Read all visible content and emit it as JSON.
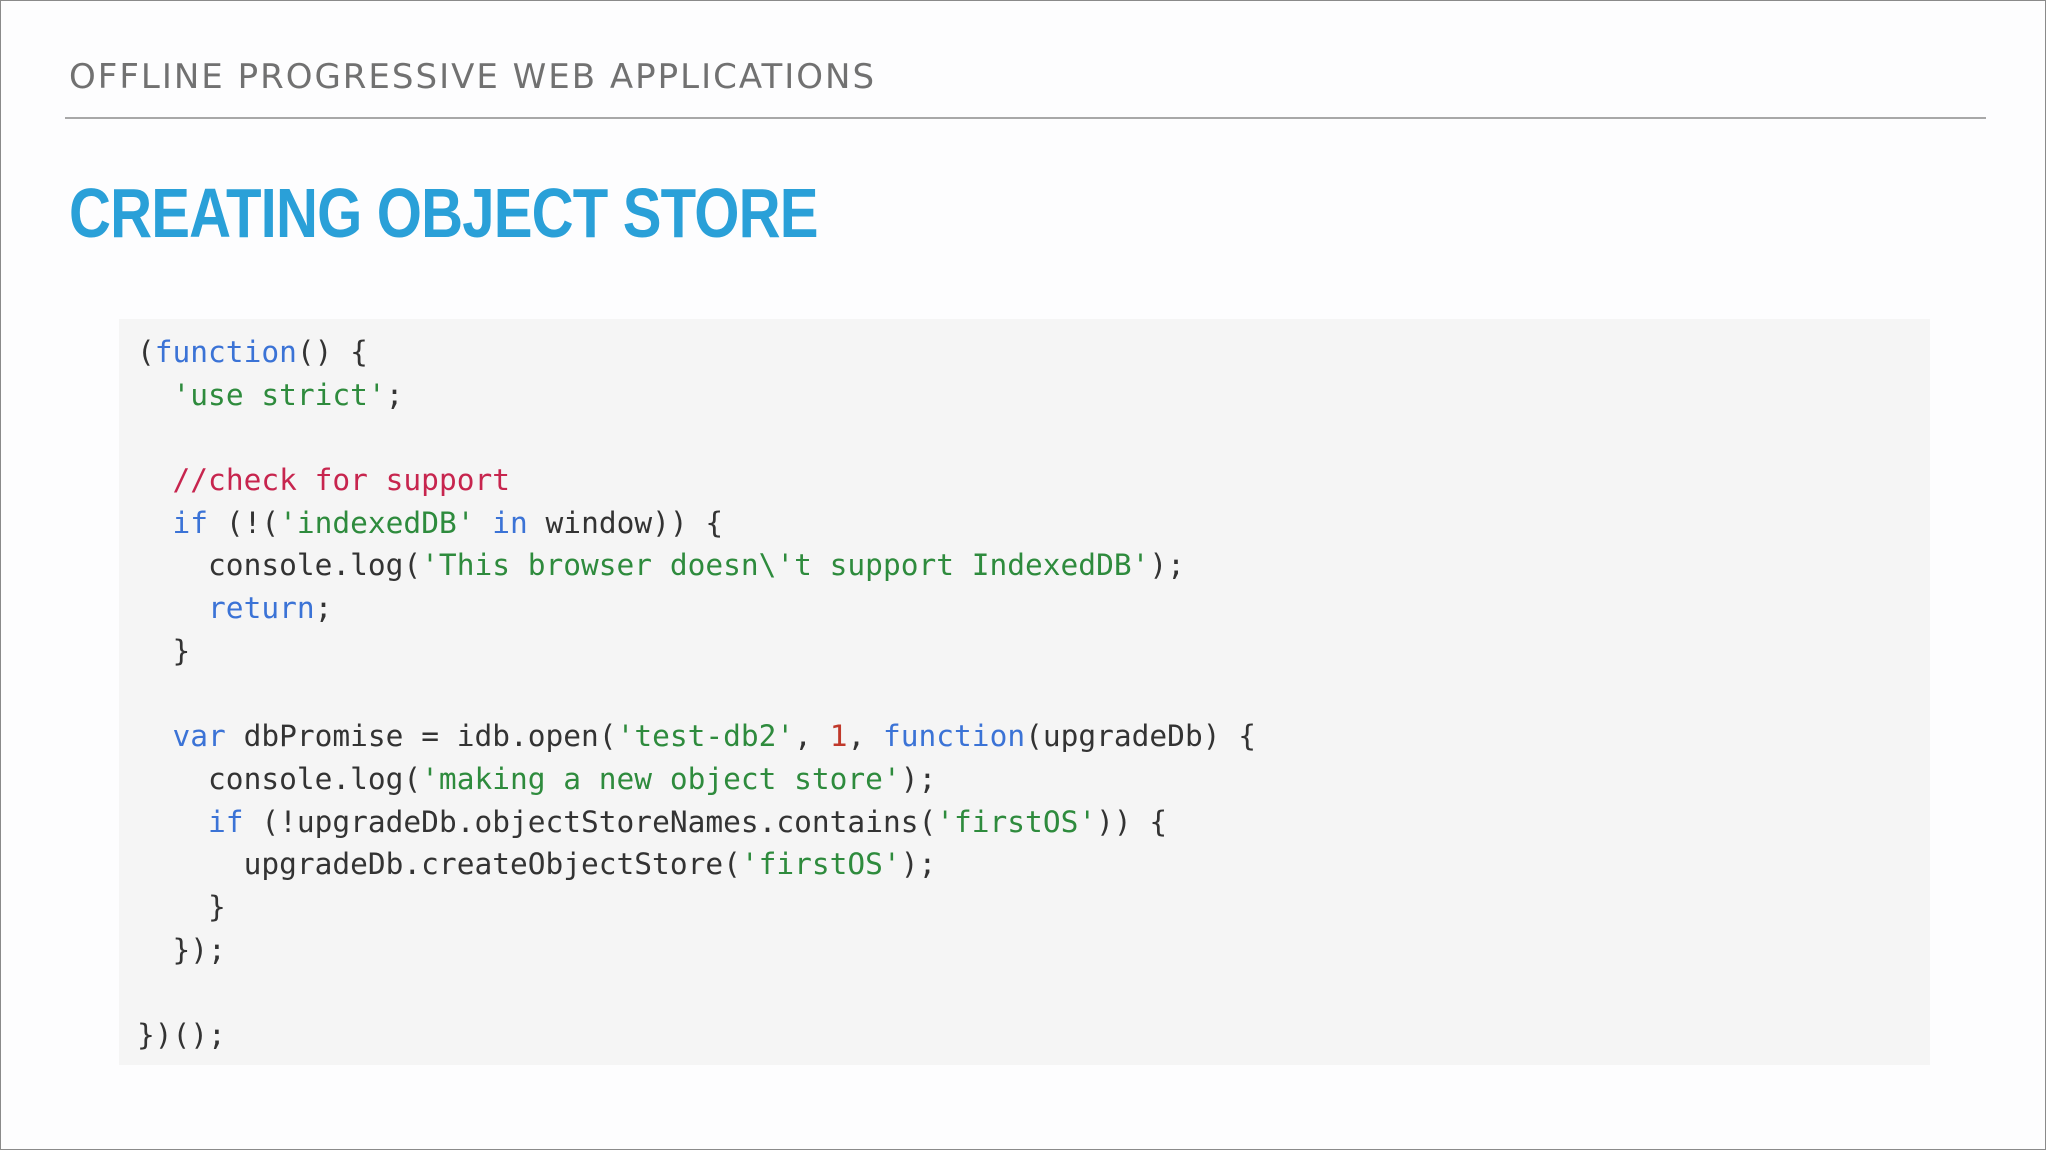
{
  "header": {
    "kicker": "OFFLINE PROGRESSIVE WEB APPLICATIONS",
    "title": "CREATING OBJECT STORE"
  },
  "colors": {
    "title": "#2aa0d8",
    "kicker": "#717171",
    "keyword": "#3b73d6",
    "string": "#2e8b3d",
    "comment": "#c7254e",
    "number": "#c0392b",
    "code_background": "#f5f5f5"
  },
  "code": {
    "language": "javascript",
    "lines": [
      [
        [
          "plain",
          "("
        ],
        [
          "kw",
          "function"
        ],
        [
          "plain",
          "() {"
        ]
      ],
      [
        [
          "plain",
          "  "
        ],
        [
          "str",
          "'use strict'"
        ],
        [
          "plain",
          ";"
        ]
      ],
      [],
      [
        [
          "plain",
          "  "
        ],
        [
          "com",
          "//check for support"
        ]
      ],
      [
        [
          "plain",
          "  "
        ],
        [
          "kw",
          "if"
        ],
        [
          "plain",
          " (!("
        ],
        [
          "str",
          "'indexedDB'"
        ],
        [
          "plain",
          " "
        ],
        [
          "kw",
          "in"
        ],
        [
          "plain",
          " window)) {"
        ]
      ],
      [
        [
          "plain",
          "    console.log("
        ],
        [
          "str",
          "'This browser doesn\\'t support IndexedDB'"
        ],
        [
          "plain",
          ");"
        ]
      ],
      [
        [
          "plain",
          "    "
        ],
        [
          "kw",
          "return"
        ],
        [
          "plain",
          ";"
        ]
      ],
      [
        [
          "plain",
          "  }"
        ]
      ],
      [],
      [
        [
          "plain",
          "  "
        ],
        [
          "kw",
          "var"
        ],
        [
          "plain",
          " dbPromise = idb.open("
        ],
        [
          "str",
          "'test-db2'"
        ],
        [
          "plain",
          ", "
        ],
        [
          "num",
          "1"
        ],
        [
          "plain",
          ", "
        ],
        [
          "kw",
          "function"
        ],
        [
          "plain",
          "(upgradeDb) {"
        ]
      ],
      [
        [
          "plain",
          "    console.log("
        ],
        [
          "str",
          "'making a new object store'"
        ],
        [
          "plain",
          ");"
        ]
      ],
      [
        [
          "plain",
          "    "
        ],
        [
          "kw",
          "if"
        ],
        [
          "plain",
          " (!upgradeDb.objectStoreNames.contains("
        ],
        [
          "str",
          "'firstOS'"
        ],
        [
          "plain",
          ")) {"
        ]
      ],
      [
        [
          "plain",
          "      upgradeDb.createObjectStore("
        ],
        [
          "str",
          "'firstOS'"
        ],
        [
          "plain",
          ");"
        ]
      ],
      [
        [
          "plain",
          "    }"
        ]
      ],
      [
        [
          "plain",
          "  });"
        ]
      ],
      [],
      [
        [
          "plain",
          "})();"
        ]
      ]
    ]
  }
}
